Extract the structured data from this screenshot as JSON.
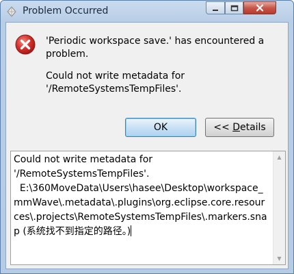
{
  "window": {
    "title": "Problem Occurred",
    "close_button_color": "#c7574a",
    "icons": {
      "app": "eclipse-app-icon",
      "minimize": "minimize-icon",
      "maximize": "maximize-icon",
      "close": "close-icon"
    }
  },
  "message": {
    "icon": "error-icon",
    "icon_color": "#d0302a",
    "line1": "'Periodic workspace save.' has encountered a problem.",
    "line2": "Could not write metadata for '/RemoteSystemsTempFiles'."
  },
  "buttons": {
    "ok_label": "OK",
    "details_prefix": "<< ",
    "details_mnemonic": "D",
    "details_rest": "etails"
  },
  "details": {
    "text": "Could not write metadata for\n'/RemoteSystemsTempFiles'.\n  E:\\360MoveData\\Users\\hasee\\Desktop\\workspace_mmWave\\.metadata\\.plugins\\org.eclipse.core.resources\\.projects\\RemoteSystemsTempFiles\\.markers.snap (系统找不到指定的路径。)"
  }
}
